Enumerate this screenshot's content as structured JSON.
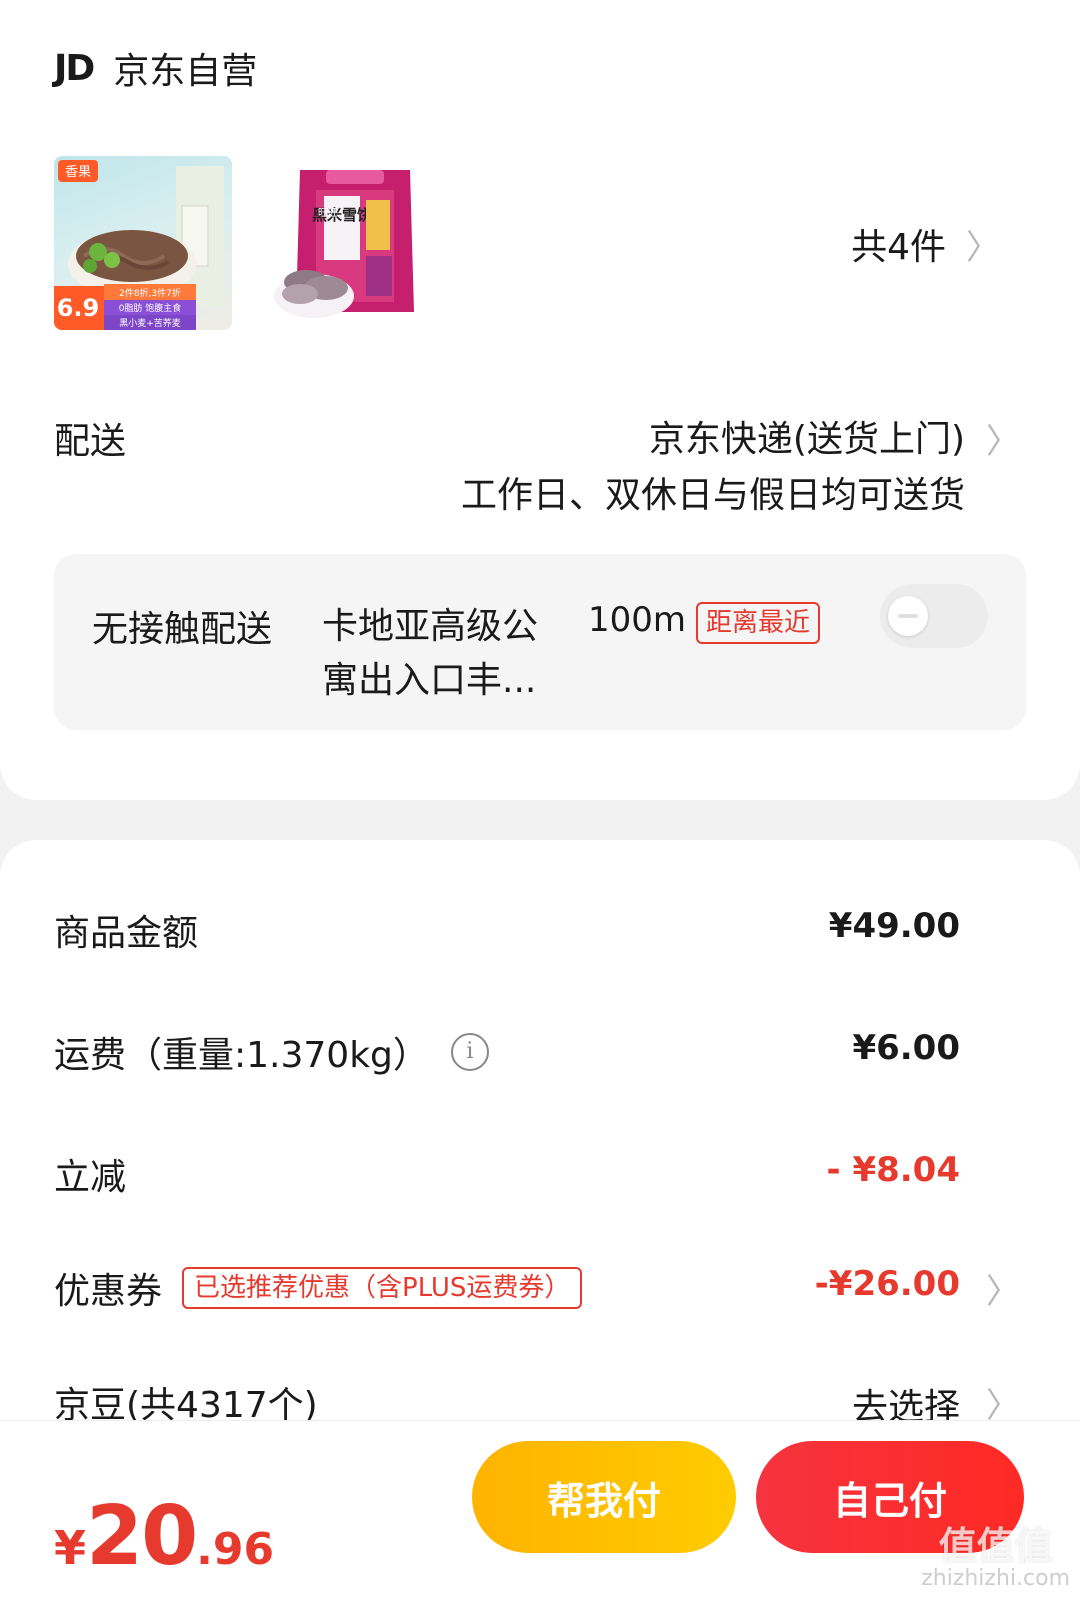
{
  "shop": {
    "logo_text": "JD",
    "name": "京东自营"
  },
  "products": {
    "count_text": "共4件",
    "item1": {
      "brand": "香果",
      "price_badge": "6.9",
      "promo": "2件8折,3件7折",
      "tags": [
        "0脂肪 饱腹主食",
        "黑小麦+苦荞麦"
      ]
    },
    "item2": {
      "label": "黑米雪饼",
      "brand": "旺旺"
    }
  },
  "delivery": {
    "label": "配送",
    "method": "京东快递(送货上门)",
    "schedule": "工作日、双休日与假日均可送货"
  },
  "contactless": {
    "label": "无接触配送",
    "address": "卡地亚高级公寓出入口丰...",
    "distance": "100m",
    "tag": "距离最近"
  },
  "summary": {
    "goods": {
      "label": "商品金额",
      "value": "¥49.00"
    },
    "shipping": {
      "label": "运费（重量:1.370kg）",
      "value": "¥6.00"
    },
    "discount": {
      "label": "立减",
      "value": "- ¥8.04"
    },
    "coupon": {
      "label": "优惠券",
      "tag": "已选推荐优惠（含PLUS运费券）",
      "value": "-¥26.00"
    },
    "jingdou": {
      "label": "京豆(共4317个)",
      "value": "去选择"
    }
  },
  "bottom": {
    "currency": "¥",
    "total_int": "20",
    "total_dec": ".96",
    "help_pay": "帮我付",
    "self_pay": "自己付"
  },
  "watermark": {
    "text": "值值值",
    "domain": "zhizhizhi.com"
  },
  "colors": {
    "accent_red": "#e63a2e",
    "help_button": "#ffb300",
    "self_button": "#ff2a24"
  }
}
